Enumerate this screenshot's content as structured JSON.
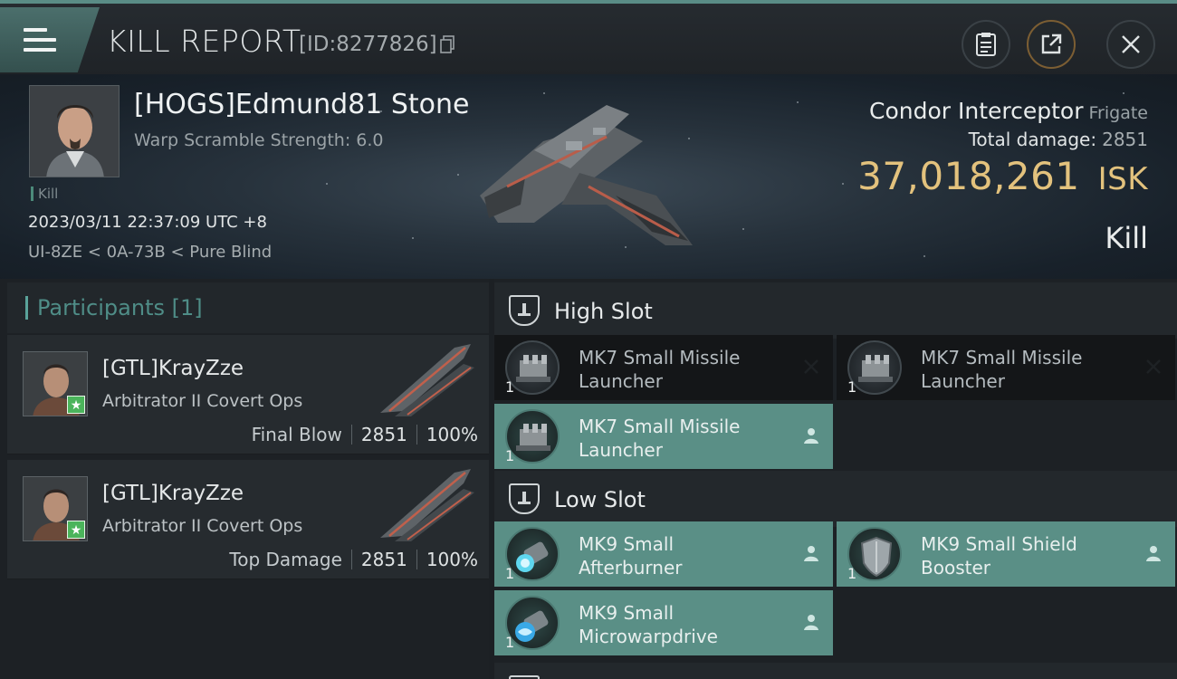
{
  "header": {
    "title": "KILL REPORT",
    "id_label": "[ID:8277826]"
  },
  "victim": {
    "name": "[HOGS]Edmund81 Stone",
    "warp_scramble": "Warp Scramble Strength: 6.0",
    "tag": "Kill",
    "datetime": "2023/03/11 22:37:09 UTC +8",
    "location": "UI-8ZE < 0A-73B < Pure Blind",
    "ship_name": "Condor Interceptor",
    "ship_class": "Frigate",
    "total_damage_label": "Total damage:",
    "total_damage": "2851",
    "isk_value": "37,018,261",
    "isk_unit": "ISK",
    "result": "Kill"
  },
  "participants": {
    "header": "Participants [1]",
    "rows": [
      {
        "name": "[GTL]KrayZze",
        "ship": "Arbitrator II Covert Ops",
        "label": "Final Blow",
        "damage": "2851",
        "percent": "100%"
      },
      {
        "name": "[GTL]KrayZze",
        "ship": "Arbitrator II Covert Ops",
        "label": "Top Damage",
        "damage": "2851",
        "percent": "100%"
      }
    ]
  },
  "fitting": {
    "high_slot": {
      "label": "High Slot",
      "modules": [
        {
          "line1": "MK7 Small Missile",
          "line2": "Launcher",
          "qty": "1",
          "state": "destroyed"
        },
        {
          "line1": "MK7 Small Missile",
          "line2": "Launcher",
          "qty": "1",
          "state": "destroyed"
        },
        {
          "line1": "MK7 Small Missile",
          "line2": "Launcher",
          "qty": "1",
          "state": "dropped"
        }
      ]
    },
    "low_slot": {
      "label": "Low Slot",
      "modules": [
        {
          "line1": "MK9 Small",
          "line2": "Afterburner",
          "qty": "1",
          "state": "dropped"
        },
        {
          "line1": "MK9 Small Shield",
          "line2": "Booster",
          "qty": "1",
          "state": "dropped"
        },
        {
          "line1": "MK9 Small",
          "line2": "Microwarpdrive",
          "qty": "1",
          "state": "dropped"
        }
      ]
    }
  },
  "colors": {
    "accent_teal": "#5a8f86",
    "isk_gold": "#e3c27d",
    "star_green": "#4bb45b"
  },
  "icons": [
    "menu-icon",
    "copy-icon",
    "clipboard-icon",
    "share-icon",
    "close-icon",
    "slot-icon",
    "remove-x-icon",
    "person-icon"
  ]
}
